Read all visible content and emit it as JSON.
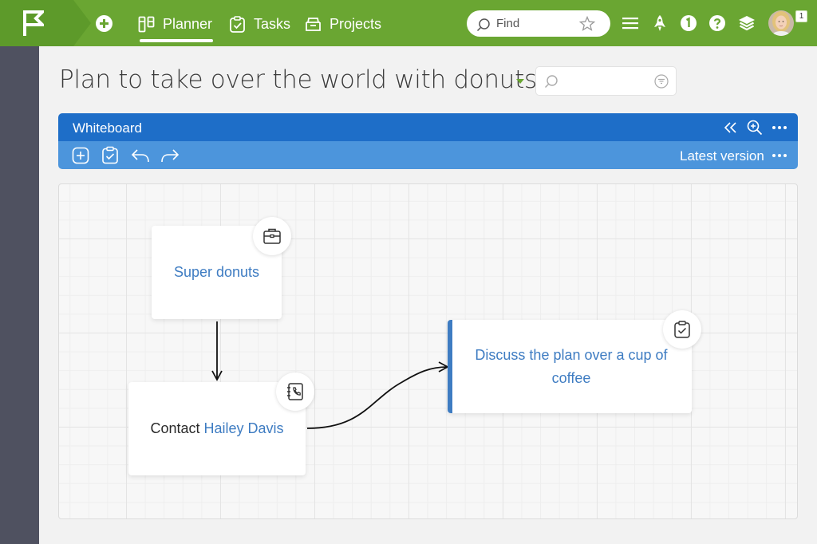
{
  "topbar": {
    "nav": [
      {
        "label": "Planner",
        "icon": "planner-icon",
        "active": true
      },
      {
        "label": "Tasks",
        "icon": "tasks-icon"
      },
      {
        "label": "Projects",
        "icon": "projects-icon"
      }
    ],
    "search_placeholder": "Find",
    "notification_count": "1",
    "colors": {
      "bar": "#6aa632",
      "logo_block": "#5d9a2a"
    }
  },
  "page": {
    "title": "Plan to take over the world with donuts"
  },
  "whiteboard": {
    "title": "Whiteboard",
    "version_label": "Latest version",
    "colors": {
      "header": "#1e6ec8",
      "toolbar": "#4c95dc"
    }
  },
  "board": {
    "cards": [
      {
        "id": "super-donuts",
        "text": "Super donuts",
        "icon": "briefcase-icon"
      },
      {
        "id": "contact",
        "prefix": "Contact ",
        "link": "Hailey Davis",
        "icon": "phone-book-icon"
      },
      {
        "id": "discuss",
        "text": "Discuss the plan over a cup of coffee",
        "icon": "task-clipboard-icon"
      }
    ]
  }
}
